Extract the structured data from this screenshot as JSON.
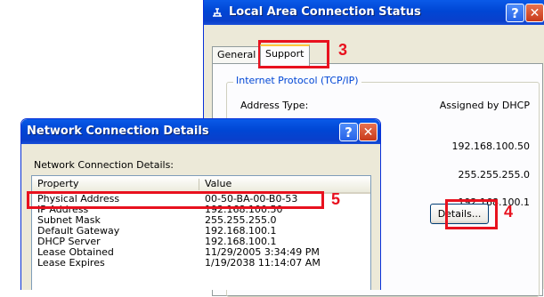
{
  "status_window": {
    "title": "Local Area Connection Status",
    "tabs": [
      {
        "label": "General"
      },
      {
        "label": "Support"
      }
    ],
    "group_label": "Internet Protocol (TCP/IP)",
    "fields": [
      {
        "label": "Address Type:",
        "value": "Assigned by DHCP"
      },
      {
        "value": "192.168.100.50"
      },
      {
        "value": "255.255.255.0"
      },
      {
        "value": "192.168.100.1"
      }
    ],
    "details_button": "Details..."
  },
  "details_window": {
    "title": "Network Connection Details",
    "caption": "Network Connection Details:",
    "columns": {
      "property": "Property",
      "value": "Value"
    },
    "rows": [
      {
        "property": "Physical Address",
        "value": "00-50-BA-00-B0-53"
      },
      {
        "property": "IP Address",
        "value": "192.168.100.50"
      },
      {
        "property": "Subnet Mask",
        "value": "255.255.255.0"
      },
      {
        "property": "Default Gateway",
        "value": "192.168.100.1"
      },
      {
        "property": "DHCP Server",
        "value": "192.168.100.1"
      },
      {
        "property": "Lease Obtained",
        "value": "11/29/2005 3:34:49 PM"
      },
      {
        "property": "Lease Expires",
        "value": "1/19/2038 11:14:07 AM"
      }
    ]
  },
  "title_buttons": {
    "help": "?",
    "close": "✕"
  },
  "annotations": {
    "step3": "3",
    "step4": "4",
    "step5": "5"
  },
  "colors": {
    "annotation": "#e8111e",
    "titlebar": "#0a5ae8",
    "group_label": "#0046d5"
  }
}
